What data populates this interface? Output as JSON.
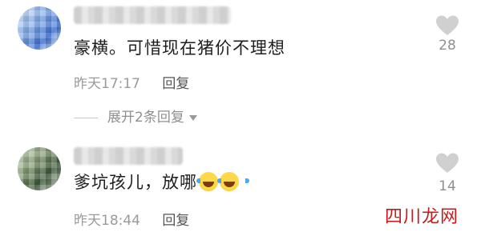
{
  "comments": [
    {
      "text": "豪横。可惜现在猪价不理想",
      "time": "昨天17:17",
      "reply_label": "回复",
      "likes": "28",
      "expand_label": "展开2条回复"
    },
    {
      "text": "爹坑孩儿，放哪",
      "time": "昨天18:44",
      "reply_label": "回复",
      "likes": "14"
    }
  ],
  "icons": {
    "like": "heart-icon",
    "expand": "chevron-down-icon",
    "emoji": "laughing-tears-emoji"
  },
  "watermark": "四川龙网"
}
